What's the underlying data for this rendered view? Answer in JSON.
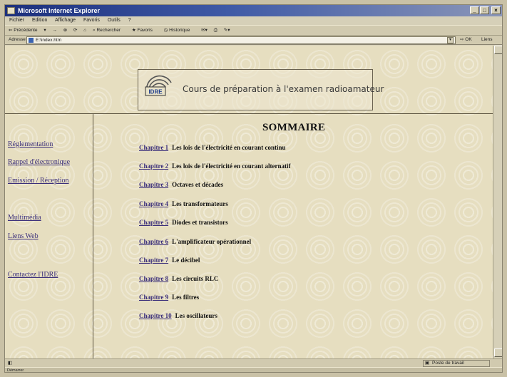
{
  "window": {
    "title": "Microsoft Internet Explorer",
    "controls": [
      "_",
      "□",
      "×"
    ]
  },
  "menubar": [
    "Fichier",
    "Edition",
    "Affichage",
    "Favoris",
    "Outils",
    "?"
  ],
  "toolbar": {
    "back": "Précédente",
    "forward": "→",
    "search": "Rechercher",
    "favorites": "Favoris",
    "history": "Historique"
  },
  "addressbar": {
    "label": "Adresse",
    "value": "E:\\index.htm",
    "go": "OK",
    "links": "Liens"
  },
  "banner": {
    "logo_text": "IDRE",
    "title": "Cours de préparation à l'examen radioamateur"
  },
  "nav": [
    "Réglementation",
    "Rappel d'électronique",
    "Emission / Réception",
    "Multimédia",
    "Liens Web",
    "Contactez l'IDRE"
  ],
  "main": {
    "heading": "SOMMAIRE",
    "chapters": [
      {
        "link": "Chapitre 1",
        "title": "Les lois de l'électricité en courant continu"
      },
      {
        "link": "Chapitre 2",
        "title": "Les lois de l'électricité en courant alternatif"
      },
      {
        "link": "Chapitre 3",
        "title": "Octaves et décades"
      },
      {
        "link": "Chapitre 4",
        "title": "Les transformateurs"
      },
      {
        "link": "Chapitre 5",
        "title": "Diodes et transistors"
      },
      {
        "link": "Chapitre 6",
        "title": "L'amplificateur opérationnel"
      },
      {
        "link": "Chapitre 7",
        "title": "Le décibel"
      },
      {
        "link": "Chapitre 8",
        "title": "Les circuits RLC"
      },
      {
        "link": "Chapitre 9",
        "title": "Les filtres"
      },
      {
        "link": "Chapitre 10",
        "title": "Les oscillateurs"
      }
    ]
  },
  "statusbar": {
    "zone": "Poste de travail"
  },
  "taskbar": {
    "start": "Démarrer"
  },
  "colors": {
    "title_bar": "#1c2f7c",
    "link": "#3a2e7a",
    "page_background": "#e6dec0"
  }
}
